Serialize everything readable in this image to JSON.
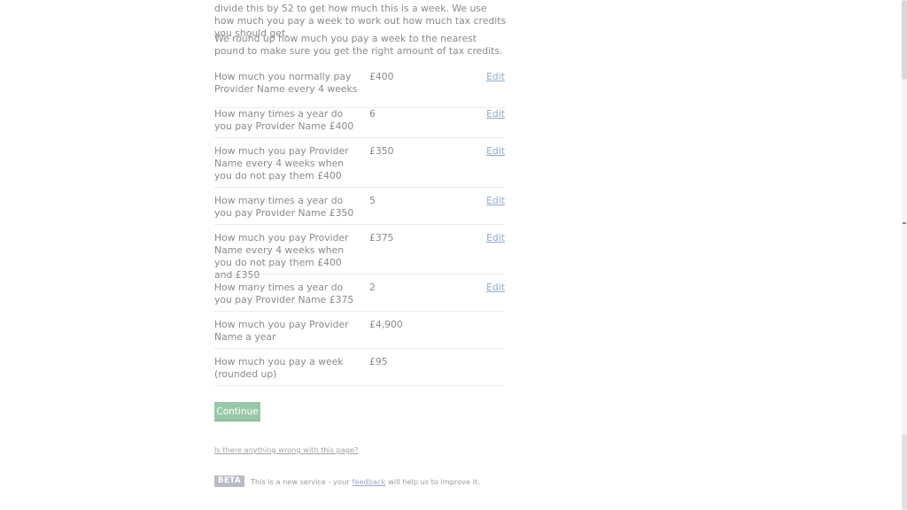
{
  "intro": {
    "para1": "divide this by 52 to get how much this is a week. We use how much you pay a week to work out how much tax credits you should get.",
    "para2": "We round up how much you pay a week to the nearest pound to make sure you get the right amount of tax credits."
  },
  "summary": {
    "rows": [
      {
        "question": "How much you normally pay Provider Name every 4 weeks",
        "answer": "£400",
        "edit": "Edit"
      },
      {
        "question": "How many times a year do you pay Provider Name £400",
        "answer": "6",
        "edit": "Edit"
      },
      {
        "question": "How much you pay Provider Name every 4 weeks when you do not pay them £400",
        "answer": "£350",
        "edit": "Edit"
      },
      {
        "question": "How many times a year do you pay Provider Name £350",
        "answer": "5",
        "edit": "Edit"
      },
      {
        "question": "How much you pay Provider Name every 4 weeks when you do not pay them £400 and £350",
        "answer": "£375",
        "edit": "Edit"
      },
      {
        "question": "How many times a year do you pay Provider Name £375",
        "answer": "2",
        "edit": "Edit"
      },
      {
        "question": "How much you pay Provider Name a year",
        "answer": "£4,900"
      },
      {
        "question": "How much you pay a week (rounded up)",
        "answer": "£95"
      }
    ]
  },
  "actions": {
    "continue_label": "Continue"
  },
  "footer": {
    "problem_link": "Is there anything wrong with this page?",
    "beta_tag": "BETA",
    "beta_text_before": "This is a new service  - your",
    "feedback_link": "feedback",
    "beta_text_after": "will help us to improve it."
  },
  "colors": {
    "button_bg": "#98c8a8",
    "link": "#93a9c6",
    "text": "#8a8a8a",
    "beta_tag_bg": "#b9bcc4"
  }
}
